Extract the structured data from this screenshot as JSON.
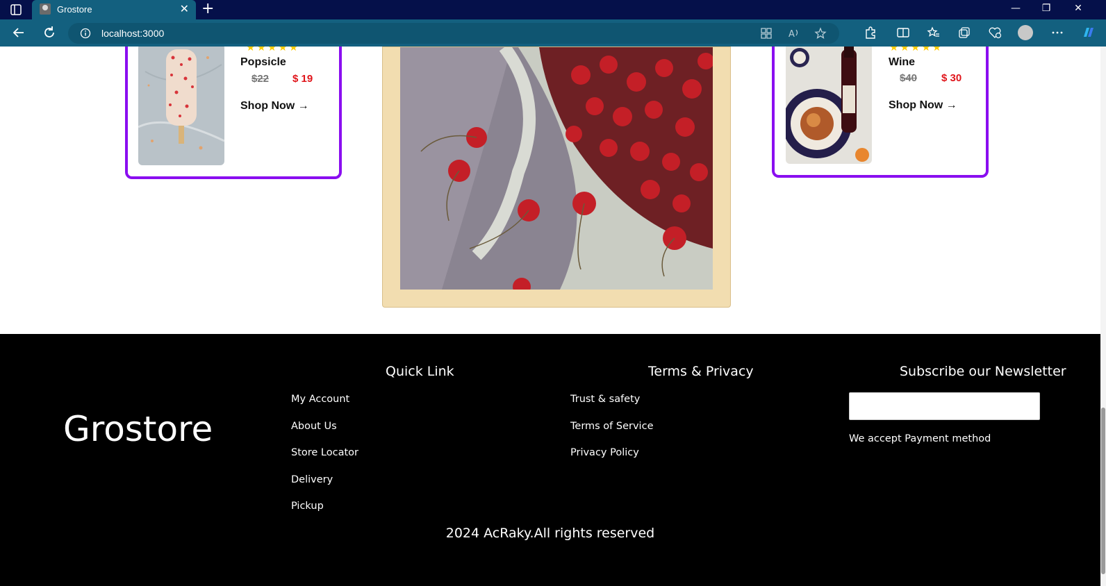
{
  "browser": {
    "tab_title": "Grostore",
    "url": "localhost:3000"
  },
  "products": [
    {
      "name": "Popsicle",
      "old_price": "$22",
      "new_price": "$ 19",
      "cta": "Shop Now →",
      "rating": 5
    },
    {
      "name": "Wine",
      "old_price": "$40",
      "new_price": "$ 30",
      "cta": "Shop Now →",
      "rating": 5
    }
  ],
  "footer": {
    "brand": "Grostore",
    "quick_link": {
      "title": "Quick Link",
      "items": [
        "My Account",
        "About Us",
        "Store Locator",
        "Delivery",
        "Pickup"
      ]
    },
    "terms": {
      "title": "Terms & Privacy",
      "items": [
        "Trust & safety",
        "Terms of Service",
        "Privacy Policy"
      ]
    },
    "newsletter": {
      "title": "Subscribe our Newsletter",
      "input_placeholder": "",
      "payment_text": "We accept Payment method"
    },
    "copyright": "2024 AcRaky.All rights reserved"
  },
  "colors": {
    "card_border": "#8a0ef0",
    "price_new": "#e0151b",
    "star": "#ffcc00",
    "frame": "#f2ddb0",
    "footer_bg": "#000000",
    "chrome_tabbar": "#05104a",
    "chrome_toolbar": "#13607f"
  }
}
